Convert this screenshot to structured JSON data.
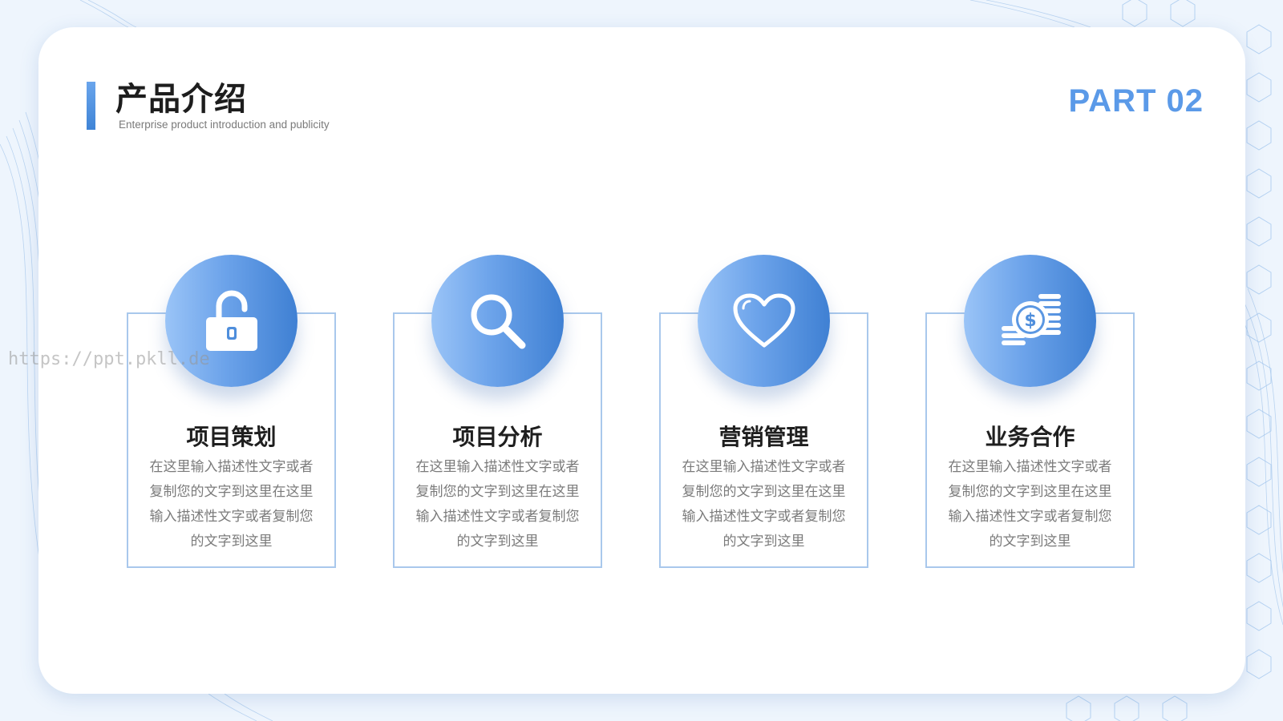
{
  "header": {
    "title": "产品介绍",
    "subtitle": "Enterprise product introduction and publicity",
    "part_label": "PART 02"
  },
  "watermark": "https://ppt.pkll.de",
  "colors": {
    "accent": "#5b9ae8",
    "accent_dark": "#3f80d3",
    "accent_light": "#9ac4f7",
    "card_border": "#a9c8ec",
    "title_text": "#1f1f1f",
    "body_text": "#7b7b7b"
  },
  "cards": [
    {
      "icon": "padlock-icon",
      "title": "项目策划",
      "desc": "在这里输入描述性文字或者复制您的文字到这里在这里输入描述性文字或者复制您的文字到这里"
    },
    {
      "icon": "magnifier-icon",
      "title": "项目分析",
      "desc": "在这里输入描述性文字或者复制您的文字到这里在这里输入描述性文字或者复制您的文字到这里"
    },
    {
      "icon": "heart-icon",
      "title": "营销管理",
      "desc": "在这里输入描述性文字或者复制您的文字到这里在这里输入描述性文字或者复制您的文字到这里"
    },
    {
      "icon": "coins-dollar-icon",
      "title": "业务合作",
      "desc": "在这里输入描述性文字或者复制您的文字到这里在这里输入描述性文字或者复制您的文字到这里"
    }
  ]
}
